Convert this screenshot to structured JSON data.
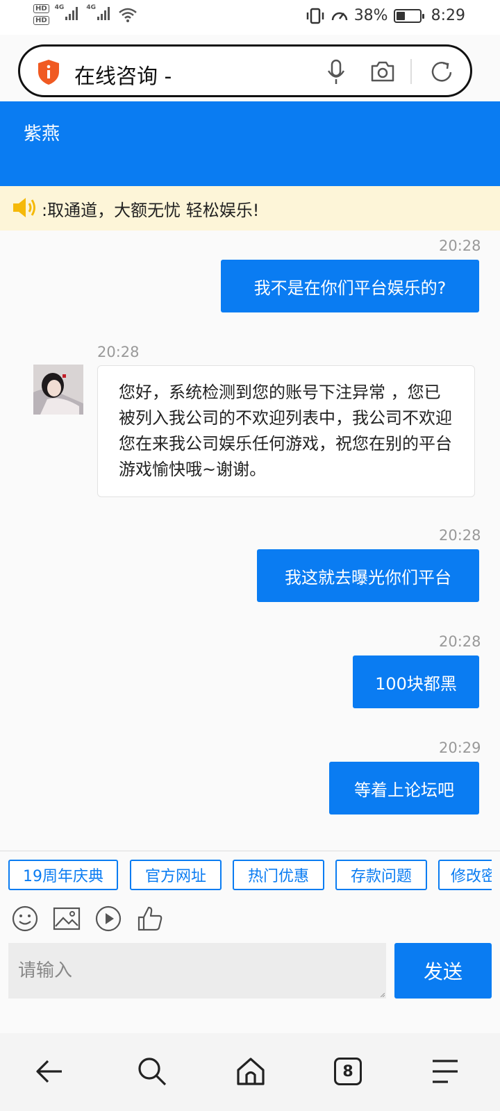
{
  "status_bar": {
    "hd_top": "HD",
    "hd_bottom": "HD",
    "network_1": "4G",
    "network_2": "4G",
    "battery_text": "38%",
    "battery_level": 0.38,
    "time": "8:29"
  },
  "url_bar": {
    "text": "在线咨询 -",
    "icons": [
      "shield-info-icon",
      "microphone-icon",
      "camera-icon",
      "reload-icon"
    ]
  },
  "header": {
    "title": "紫燕"
  },
  "marquee": {
    "text": ":取通道，大额无忧 轻松娱乐!"
  },
  "messages": [
    {
      "time": "20:28",
      "text": "我不是在你们平台娱乐的?"
    },
    {
      "time": "20:28",
      "text": "您好，系统检测到您的账号下注异常 ，您已被列入我公司的不欢迎列表中，我公司不欢迎您在来我公司娱乐任何游戏，祝您在别的平台游戏愉快哦~谢谢。"
    },
    {
      "time": "20:28",
      "text": "我这就去曝光你们平台"
    },
    {
      "time": "20:28",
      "text": "100块都黑"
    },
    {
      "time": "20:29",
      "text": "等着上论坛吧"
    }
  ],
  "quick_replies": [
    "19周年庆典",
    "官方网址",
    "热门优惠",
    "存款问题",
    "修改密"
  ],
  "toolbar_icons": [
    "emoji-icon",
    "image-icon",
    "video-icon",
    "like-icon"
  ],
  "input": {
    "placeholder": "请输入",
    "send_label": "发送"
  },
  "bottom_nav": {
    "tab_count": "8",
    "icons": [
      "back-icon",
      "search-icon",
      "home-icon",
      "tabs-icon",
      "menu-icon"
    ]
  },
  "colors": {
    "accent": "#0a7cf2",
    "marquee_bg": "#fdf5d8"
  }
}
